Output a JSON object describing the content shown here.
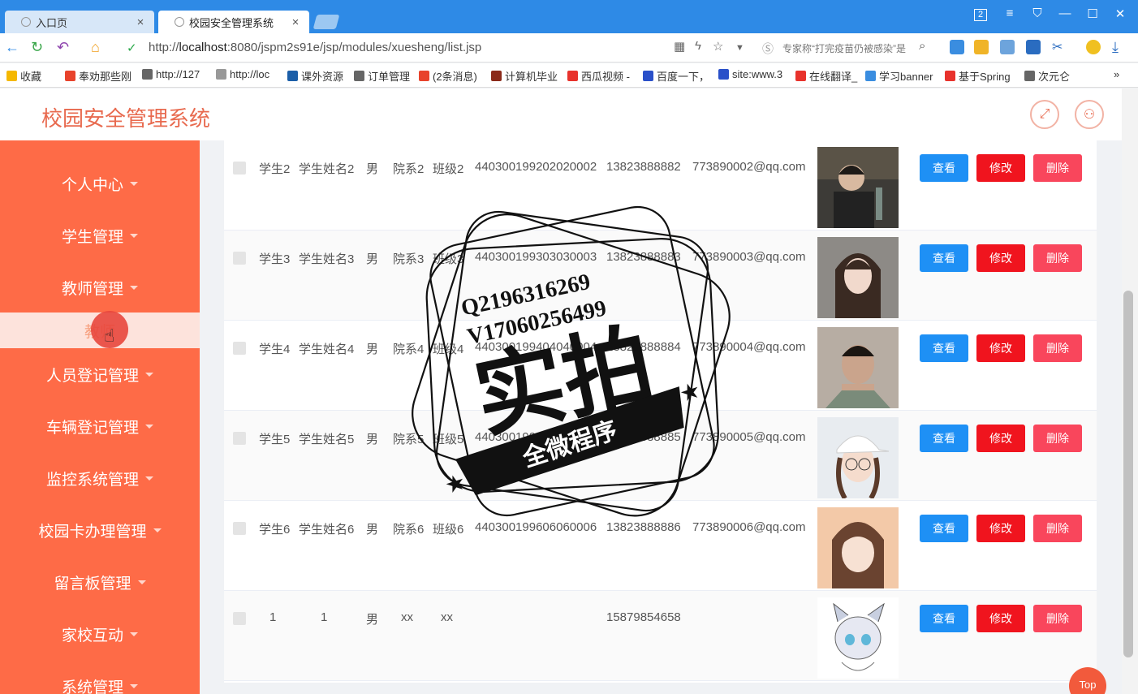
{
  "browser": {
    "tabs": [
      {
        "title": "入口页",
        "close": "×"
      },
      {
        "title": "校园安全管理系统",
        "close": "×"
      }
    ],
    "url_prefix": "http://",
    "url_host": "localhost",
    "url_rest": ":8080/jspm2s91e/jsp/modules/xuesheng/list.jsp",
    "search_hint": "专家称“打完疫苗仍被感染”是",
    "bookmarks": [
      "收藏",
      "奉劝那些刚",
      "http://127",
      "http://loc",
      "课外资源",
      "订单管理",
      "(2条消息)",
      "计算机毕业",
      "西瓜视频 -",
      "百度一下，",
      "site:www.3",
      "在线翻译_",
      "学习banner",
      "基于Spring",
      "次元仑"
    ],
    "bookmark_colors": [
      "#f5b800",
      "#e8432c",
      "#666",
      "#999",
      "#1b5ea8",
      "#666",
      "#e8432c",
      "#8b2a1a",
      "#e8322c",
      "#2a50c9",
      "#2a50c9",
      "#e8322c",
      "#3a8de0",
      "#e8322c",
      "#666"
    ],
    "window_controls": [
      "2",
      "≡",
      "⛉",
      "—",
      "☐",
      "✕"
    ]
  },
  "header": {
    "title": "校园安全管理系统"
  },
  "sidebar": {
    "items": [
      {
        "label": "个人中心"
      },
      {
        "label": "学生管理"
      },
      {
        "label": "教师管理"
      },
      {
        "label": "教师"
      },
      {
        "label": "人员登记管理"
      },
      {
        "label": "车辆登记管理"
      },
      {
        "label": "监控系统管理"
      },
      {
        "label": "校园卡办理管理"
      },
      {
        "label": "留言板管理"
      },
      {
        "label": "家校互动"
      },
      {
        "label": "系统管理"
      }
    ]
  },
  "table": {
    "buttons": {
      "view": "查看",
      "edit": "修改",
      "delete": "删除"
    },
    "rows": [
      {
        "id": "学生2",
        "name": "学生姓名2",
        "gender": "男",
        "dept": "院系2",
        "cls": "班级2",
        "idcard": "440300199202020002",
        "phone": "13823888882",
        "email": "773890002@qq.com",
        "photo": "photo-man-bar"
      },
      {
        "id": "学生3",
        "name": "学生姓名3",
        "gender": "男",
        "dept": "院系3",
        "cls": "班级3",
        "idcard": "440300199303030003",
        "phone": "13823888883",
        "email": "773890003@qq.com",
        "photo": "photo-woman-long-hair"
      },
      {
        "id": "学生4",
        "name": "学生姓名4",
        "gender": "男",
        "dept": "院系4",
        "cls": "班级4",
        "idcard": "440300199404040004",
        "phone": "13823888884",
        "email": "773890004@qq.com",
        "photo": "photo-man-tattoo"
      },
      {
        "id": "学生5",
        "name": "学生姓名5",
        "gender": "男",
        "dept": "院系5",
        "cls": "班级5",
        "idcard": "440300199505050005",
        "phone": "13823888885",
        "email": "773890005@qq.com",
        "photo": "photo-girl-cap"
      },
      {
        "id": "学生6",
        "name": "学生姓名6",
        "gender": "男",
        "dept": "院系6",
        "cls": "班级6",
        "idcard": "440300199606060006",
        "phone": "13823888886",
        "email": "773890006@qq.com",
        "photo": "photo-girl-wink"
      },
      {
        "id": "1",
        "name": "1",
        "gender": "男",
        "dept": "xx",
        "cls": "xx",
        "idcard": "",
        "phone": "15879854658",
        "email": "",
        "photo": "photo-cat-boy-drawing"
      }
    ]
  },
  "watermark": {
    "line1": "Q2196316269",
    "line2": "V17060256499",
    "big": "实拍",
    "band": "全微程序"
  },
  "top_button": "Top",
  "colors": {
    "sidebar": "#fe6b47",
    "accent": "#e86a4f",
    "view_btn": "#1e90f5",
    "edit_btn": "#f0141e",
    "delete_btn": "#f9465c",
    "browser_blue": "#2e8ae6"
  }
}
